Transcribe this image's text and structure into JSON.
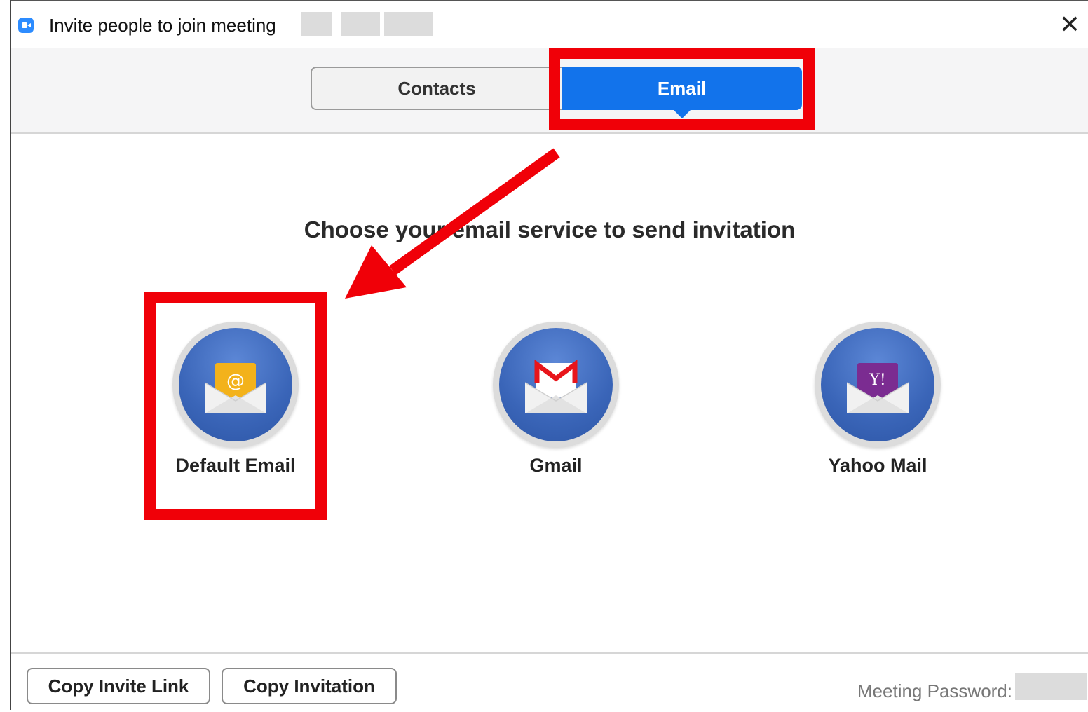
{
  "window": {
    "title": "Invite people to join meeting",
    "close_icon": "close-icon"
  },
  "tabs": [
    {
      "label": "Contacts",
      "active": false
    },
    {
      "label": "Email",
      "active": true
    }
  ],
  "main": {
    "heading": "Choose your email service to send invitation",
    "services": [
      {
        "label": "Default Email",
        "icon": "envelope-at-icon"
      },
      {
        "label": "Gmail",
        "icon": "gmail-icon"
      },
      {
        "label": "Yahoo Mail",
        "icon": "yahoo-mail-icon"
      }
    ]
  },
  "footer": {
    "copy_link_label": "Copy Invite Link",
    "copy_invitation_label": "Copy Invitation",
    "password_label": "Meeting Password:"
  },
  "colors": {
    "accent": "#1273eb",
    "annotation": "#f00008"
  }
}
